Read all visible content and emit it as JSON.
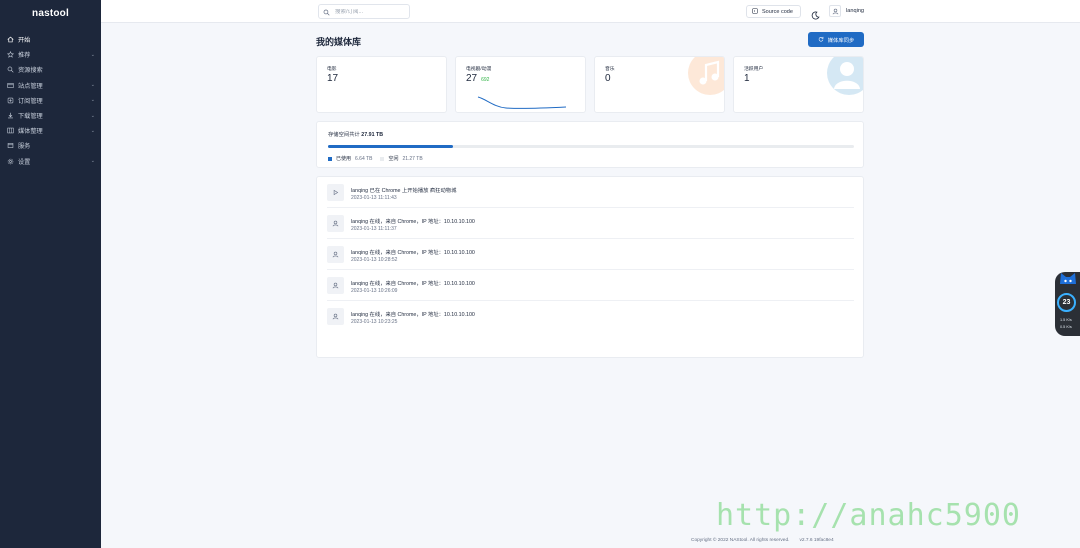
{
  "app": {
    "logo": "nastool"
  },
  "sidebar": {
    "items": [
      {
        "label": "开始",
        "icon": "home-icon",
        "chevron": false,
        "active": true
      },
      {
        "label": "推荐",
        "icon": "star-icon",
        "chevron": true
      },
      {
        "label": "资源搜索",
        "icon": "search-icon",
        "chevron": false
      },
      {
        "label": "站点管理",
        "icon": "site-icon",
        "chevron": true
      },
      {
        "label": "订阅管理",
        "icon": "subscribe-icon",
        "chevron": true
      },
      {
        "label": "下载管理",
        "icon": "download-icon",
        "chevron": true
      },
      {
        "label": "媒体整理",
        "icon": "media-icon",
        "chevron": true
      },
      {
        "label": "服务",
        "icon": "service-icon",
        "chevron": false
      },
      {
        "label": "设置",
        "icon": "settings-icon",
        "chevron": true
      }
    ]
  },
  "header": {
    "search_placeholder": "搜索/订阅...",
    "source_code_label": "Source code",
    "username": "lanqing"
  },
  "page": {
    "title": "我的媒体库",
    "sync_button": "媒体库同步"
  },
  "stats": [
    {
      "title": "电影",
      "value": "17",
      "sub": ""
    },
    {
      "title": "电视剧/动漫",
      "value": "27",
      "sub": "692"
    },
    {
      "title": "音乐",
      "value": "0",
      "sub": ""
    },
    {
      "title": "活跃用户",
      "value": "1",
      "sub": ""
    }
  ],
  "storage": {
    "label": "存储空间共计",
    "total": "27.91 TB",
    "used_fraction": 0.238,
    "used_label": "已使用",
    "used_value": "6.64 TB",
    "free_label": "空闲",
    "free_value": "21.27 TB",
    "colors": {
      "used": "#206bc4",
      "free": "#e9ecef"
    }
  },
  "activity": [
    {
      "icon": "play-icon",
      "message": "lanqing 已在 Chrome 上开始播放 疯狂动物城",
      "time": "2023-01-13 11:11:43"
    },
    {
      "icon": "user-icon",
      "message": "lanqing 在线，来自 Chrome，IP 地址：10.10.10.100",
      "time": "2023-01-13 11:11:37"
    },
    {
      "icon": "user-icon",
      "message": "lanqing 在线，来自 Chrome，IP 地址：10.10.10.100",
      "time": "2023-01-13 10:28:52"
    },
    {
      "icon": "user-icon",
      "message": "lanqing 在线，来自 Chrome，IP 地址：10.10.10.100",
      "time": "2023-01-13 10:26:09"
    },
    {
      "icon": "user-icon",
      "message": "lanqing 在线，来自 Chrome，IP 地址：10.10.10.100",
      "time": "2023-01-13 10:23:25"
    }
  ],
  "footer": {
    "copyright": "Copyright © 2022 NAStool. All rights reserved.",
    "version": "v2.7.6 19fac8e4"
  },
  "widget": {
    "temp": "23",
    "up": "1.5 K/s",
    "down": "0.5 K/s"
  },
  "watermark": "http://anahc5900",
  "theme": {
    "accent": "#206bc4",
    "sidebar_bg": "#1d273b",
    "page_bg": "#f5f7fb",
    "positive": "#2fb344"
  }
}
